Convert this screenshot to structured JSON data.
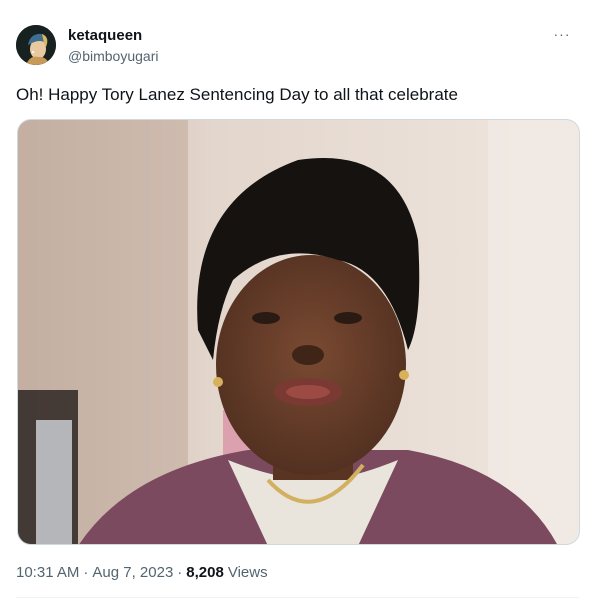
{
  "user": {
    "display_name": "ketaqueen",
    "handle": "@bimboyugari",
    "avatar_icon": "avatar-girl-with-pearl-earring"
  },
  "more_icon": "more-horizontal-icon",
  "more_glyph": "···",
  "tweet": {
    "text": "Oh! Happy Tory Lanez Sentencing Day to all that celebrate"
  },
  "meta": {
    "time": "10:31 AM",
    "separator": "·",
    "date": "Aug 7, 2023",
    "views_count": "8,208",
    "views_label": "Views"
  },
  "colors": {
    "text_primary": "#0f1419",
    "text_secondary": "#536471",
    "border": "#cfd9de"
  }
}
